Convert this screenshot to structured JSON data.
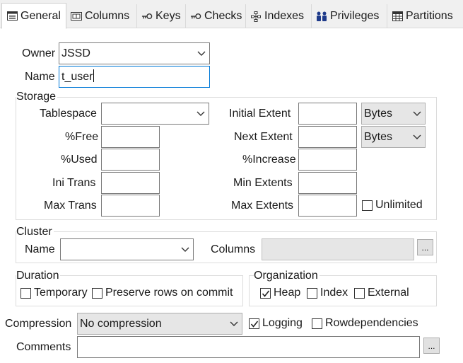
{
  "tabs": [
    {
      "label": "General",
      "icon": "table-form-icon"
    },
    {
      "label": "Columns",
      "icon": "columns-icon"
    },
    {
      "label": "Keys",
      "icon": "key-icon"
    },
    {
      "label": "Checks",
      "icon": "check-constraint-icon"
    },
    {
      "label": "Indexes",
      "icon": "index-icon"
    },
    {
      "label": "Privileges",
      "icon": "users-icon"
    },
    {
      "label": "Partitions",
      "icon": "grid-icon"
    }
  ],
  "owner": {
    "label": "Owner",
    "value": "JSSD"
  },
  "name": {
    "label": "Name",
    "value": "t_user"
  },
  "storage": {
    "title": "Storage",
    "tablespace": {
      "label": "Tablespace",
      "value": ""
    },
    "free": {
      "label": "%Free",
      "value": ""
    },
    "used": {
      "label": "%Used",
      "value": ""
    },
    "ini_trans": {
      "label": "Ini Trans",
      "value": ""
    },
    "max_trans": {
      "label": "Max Trans",
      "value": ""
    },
    "initial_extent": {
      "label": "Initial Extent",
      "value": "",
      "unit": "Bytes"
    },
    "next_extent": {
      "label": "Next Extent",
      "value": "",
      "unit": "Bytes"
    },
    "increase": {
      "label": "%Increase",
      "value": ""
    },
    "min_extents": {
      "label": "Min Extents",
      "value": ""
    },
    "max_extents": {
      "label": "Max Extents",
      "value": ""
    },
    "unlimited": {
      "label": "Unlimited",
      "checked": false
    }
  },
  "cluster": {
    "title": "Cluster",
    "name_label": "Name",
    "name_value": "",
    "columns_label": "Columns",
    "columns_value": "",
    "browse_label": "..."
  },
  "duration": {
    "title": "Duration",
    "temporary": {
      "label": "Temporary",
      "checked": false
    },
    "preserve": {
      "label": "Preserve rows on commit",
      "checked": false
    }
  },
  "organization": {
    "title": "Organization",
    "heap": {
      "label": "Heap",
      "checked": true
    },
    "index": {
      "label": "Index",
      "checked": false
    },
    "external": {
      "label": "External",
      "checked": false
    }
  },
  "compression": {
    "label": "Compression",
    "value": "No compression"
  },
  "logging": {
    "label": "Logging",
    "checked": true
  },
  "rowdependencies": {
    "label": "Rowdependencies",
    "checked": false
  },
  "comments": {
    "label": "Comments",
    "value": "",
    "browse_label": "..."
  }
}
